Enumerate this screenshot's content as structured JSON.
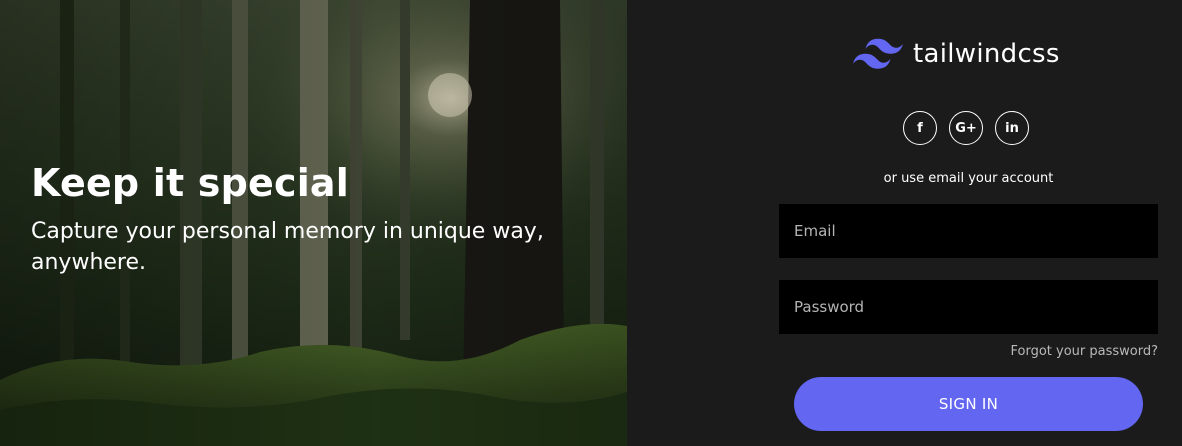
{
  "hero": {
    "title": "Keep it special",
    "subtitle": "Capture your personal memory in unique way, anywhere."
  },
  "brand": {
    "name": "tailwindcss",
    "logo_icon": "tailwind-logo-icon",
    "accent_color": "#6366f1"
  },
  "social": {
    "buttons": [
      {
        "label": "f",
        "icon": "facebook-icon"
      },
      {
        "label": "G+",
        "icon": "google-plus-icon"
      },
      {
        "label": "in",
        "icon": "linkedin-icon"
      }
    ]
  },
  "form": {
    "divider_text": "or use email your account",
    "email_placeholder": "Email",
    "password_placeholder": "Password",
    "forgot_label": "Forgot your password?",
    "submit_label": "SIGN IN"
  }
}
